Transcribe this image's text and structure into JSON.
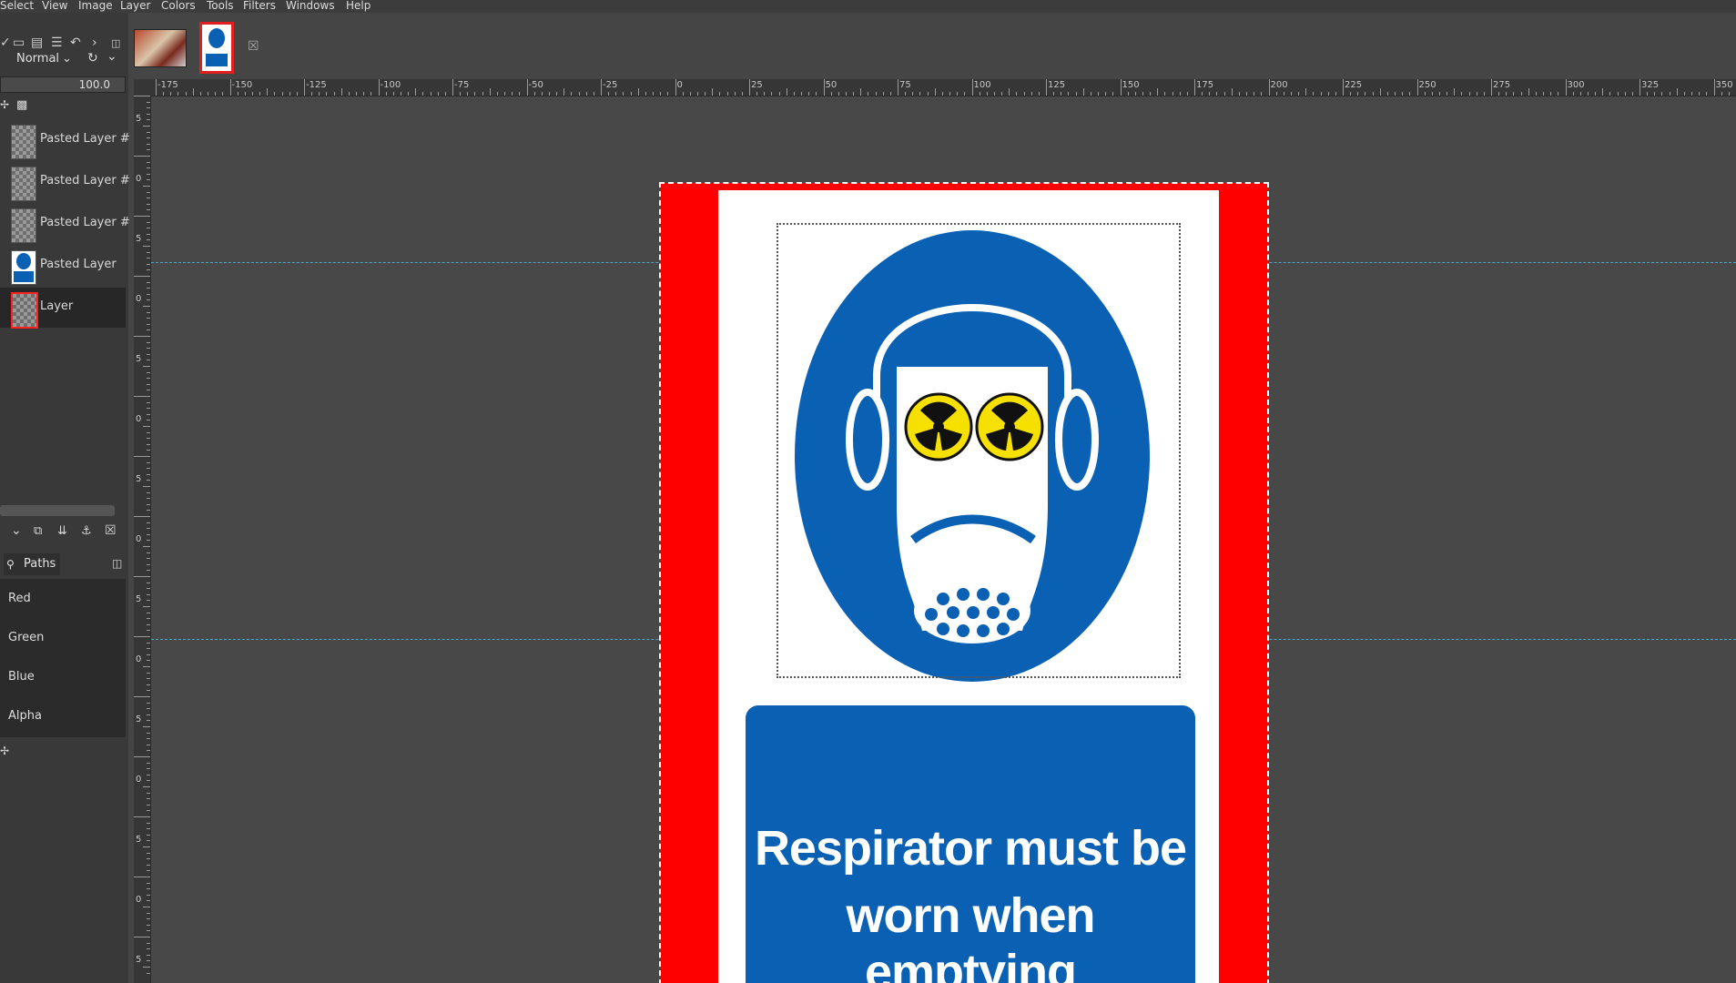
{
  "menubar": {
    "items": [
      "Select",
      "View",
      "Image",
      "Layer",
      "Colors",
      "Tools",
      "Filters",
      "Windows",
      "Help"
    ]
  },
  "layers_panel": {
    "mode": "Normal",
    "opacity": "100.0",
    "layers": [
      {
        "name": "Pasted Layer #",
        "active": false
      },
      {
        "name": "Pasted Layer #",
        "active": false
      },
      {
        "name": "Pasted Layer #",
        "active": false
      },
      {
        "name": "Pasted Layer",
        "active": false
      },
      {
        "name": "Layer",
        "active": true
      }
    ]
  },
  "paths_panel": {
    "tab_label": "Paths",
    "channels": [
      "Red",
      "Green",
      "Blue",
      "Alpha"
    ]
  },
  "ruler": {
    "h_labels": [
      "-175",
      "-150",
      "-125",
      "-100",
      "-75",
      "-50",
      "-25",
      "0",
      "25",
      "50",
      "75",
      "100",
      "125",
      "150",
      "175",
      "200",
      "225",
      "250",
      "275",
      "300",
      "325",
      "350"
    ],
    "v_labels": [
      "5",
      "0",
      "5",
      "0",
      "5",
      "0",
      "5",
      "0",
      "5",
      "0",
      "5",
      "0",
      "5",
      "0",
      "5"
    ]
  },
  "canvas": {
    "sign_text_line1": "Respirator must be",
    "sign_text_line2": "worn when emptying"
  },
  "colors": {
    "sign_red": "#ff0000",
    "sign_blue": "#0a60b3",
    "guide": "#49a7c8",
    "radiation_yellow": "#f5e000"
  }
}
